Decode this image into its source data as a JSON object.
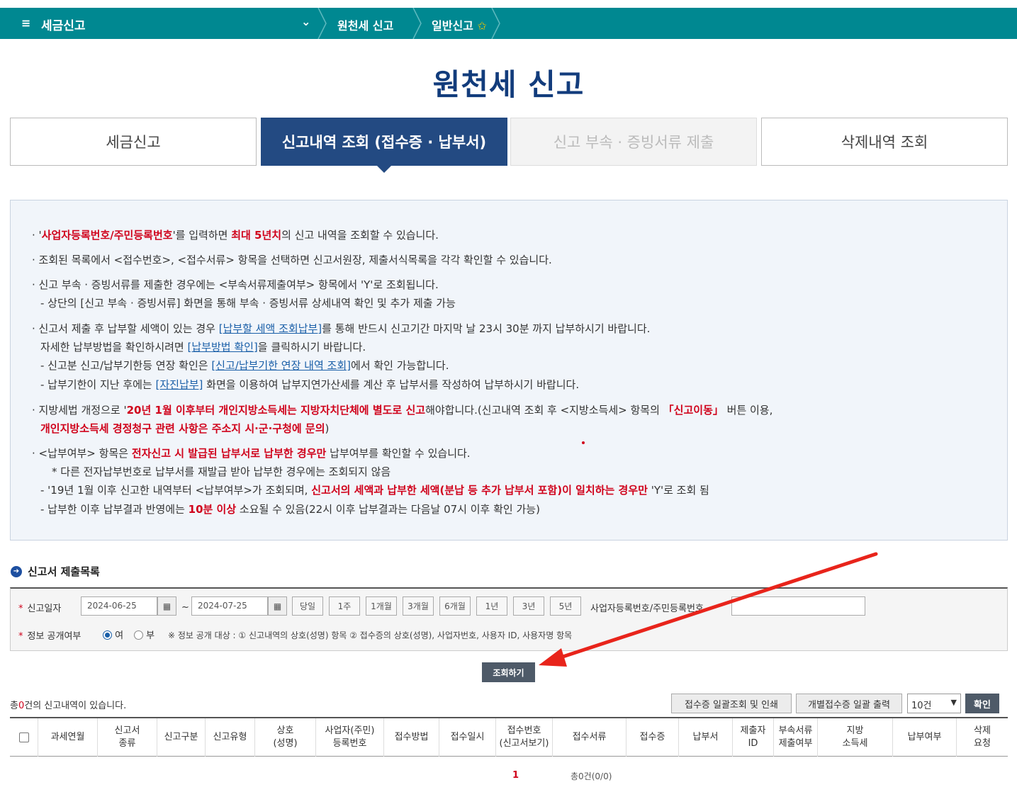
{
  "topbar": {
    "menu_icon": "≡",
    "menu_title": "세금신고",
    "chevron": "⌄",
    "crumb1": "원천세 신고",
    "crumb2": "일반신고",
    "star": "✩"
  },
  "page_title": "원천세 신고",
  "tabs": [
    {
      "label": "세금신고"
    },
    {
      "label": "신고내역 조회 (접수증 · 납부서)"
    },
    {
      "label": "신고 부속 · 증빙서류 제출"
    },
    {
      "label": "삭제내역 조회"
    }
  ],
  "info": {
    "l1": [
      "· '",
      "사업자등록번호/주민등록번호",
      "'를 입력하면 ",
      "최대 5년치",
      "의 신고 내역을 조회할 수 있습니다."
    ],
    "l2": "· 조회된 목록에서 <접수번호>, <접수서류> 항목을 선택하면 신고서원장, 제출서식목록을 각각 확인할 수 있습니다.",
    "l3": "· 신고 부속 · 증빙서류를 제출한 경우에는 <부속서류제출여부> 항목에서 'Y'로 조회됩니다.",
    "l4": "- 상단의 [신고 부속 · 증빙서류] 화면을 통해 부속 · 증빙서류 상세내역 확인 및 추가 제출 가능",
    "l5": [
      "· 신고서 제출 후 납부할 세액이 있는 경우 ",
      "[납부할 세액 조회납부]",
      "를 통해 반드시 신고기간 마지막 날 23시 30분 까지 납부하시기 바랍니다."
    ],
    "l6": [
      "자세한 납부방법을 확인하시려면 ",
      "[납부방법 확인]",
      "을 클릭하시기 바랍니다."
    ],
    "l7": [
      "- 신고분 신고/납부기한등 연장 확인은 ",
      "[신고/납부기한 연장 내역 조회]",
      "에서 확인 가능합니다."
    ],
    "l8": [
      "- 납부기한이 지난 후에는 ",
      "[자진납부]",
      " 화면을 이용하여 납부지연가산세를 계산 후 납부서를 작성하여 납부하시기 바랍니다."
    ],
    "l9": [
      "· 지방세법 개정으로 '",
      "20년 1월 이후부터 개인지방소득세는 지방자치단체에 별도로 신고",
      "해야합니다.(신고내역 조회 후 <지방소득세> 항목의 ",
      "「신고이동」",
      " 버튼 이용,"
    ],
    "l10": [
      "개인지방소득세 경정청구 관련 사항은 주소지 시·군·구청에 문의",
      ")"
    ],
    "l11": [
      "· <납부여부> 항목은 ",
      "전자신고 시 발급된 납부서로 납부한 경우만",
      " 납부여부를 확인할 수 있습니다."
    ],
    "l12": "* 다른 전자납부번호로 납부서를 재발급 받아 납부한 경우에는 조회되지 않음",
    "l13": [
      "- '19년 1월 이후 신고한 내역부터 <납부여부>가 조회되며, ",
      "신고서의 세액과 납부한 세액(분납 등 추가 납부서 포함)이 일치하는 경우만",
      " 'Y'로 조회 됨"
    ],
    "l14": [
      "- 납부한 이후 납부결과 반영에는 ",
      "10분 이상",
      " 소요될 수 있음(22시 이후 납부결과는 다음날 07시 이후 확인 가능)"
    ]
  },
  "section": {
    "icon": "➔",
    "title": "신고서 제출목록"
  },
  "search": {
    "date_label": "신고일자",
    "req_mark": "*",
    "date_from": "2024-06-25",
    "date_to": "2024-07-25",
    "tilde": "~",
    "cal_icon": "▦",
    "periods": [
      "당일",
      "1주",
      "1개월",
      "3개월",
      "6개월",
      "1년",
      "3년",
      "5년"
    ],
    "biz_label": "사업자등록번호/주민등록번호",
    "biz_value": "",
    "public_label": "정보 공개여부",
    "yes": "여",
    "no": "부",
    "public_note": "※ 정보 공개 대상 : ① 신고내역의 상호(성명) 항목 ② 접수증의 상호(성명), 사업자번호, 사용자 ID, 사용자명 항목"
  },
  "search_button": "조회하기",
  "result": {
    "total_prefix": "총",
    "total_count": "0",
    "total_suffix": "건의 신고내역이 있습니다.",
    "btn_batch": "접수증 일괄조회 및 인쇄",
    "btn_individual": "개별접수증 일괄 출력",
    "page_size": "10건",
    "confirm": "확인"
  },
  "table": {
    "headers": [
      "과세연월",
      "신고서\n종류",
      "신고구분",
      "신고유형",
      "상호\n(성명)",
      "사업자(주민)\n등록번호",
      "접수방법",
      "접수일시",
      "접수번호\n(신고서보기)",
      "접수서류",
      "접수증",
      "납부서",
      "제출자\nID",
      "부속서류\n제출여부",
      "지방\n소득세",
      "납부여부",
      "삭제\n요청"
    ]
  },
  "pager": {
    "page": "1",
    "count": "총0건(0/0)"
  },
  "colors": {
    "topbar": "#008891",
    "title": "#123c7c",
    "active_tab": "#234a82",
    "accent_red": "#d0021b",
    "arrow": "#e8241b"
  }
}
